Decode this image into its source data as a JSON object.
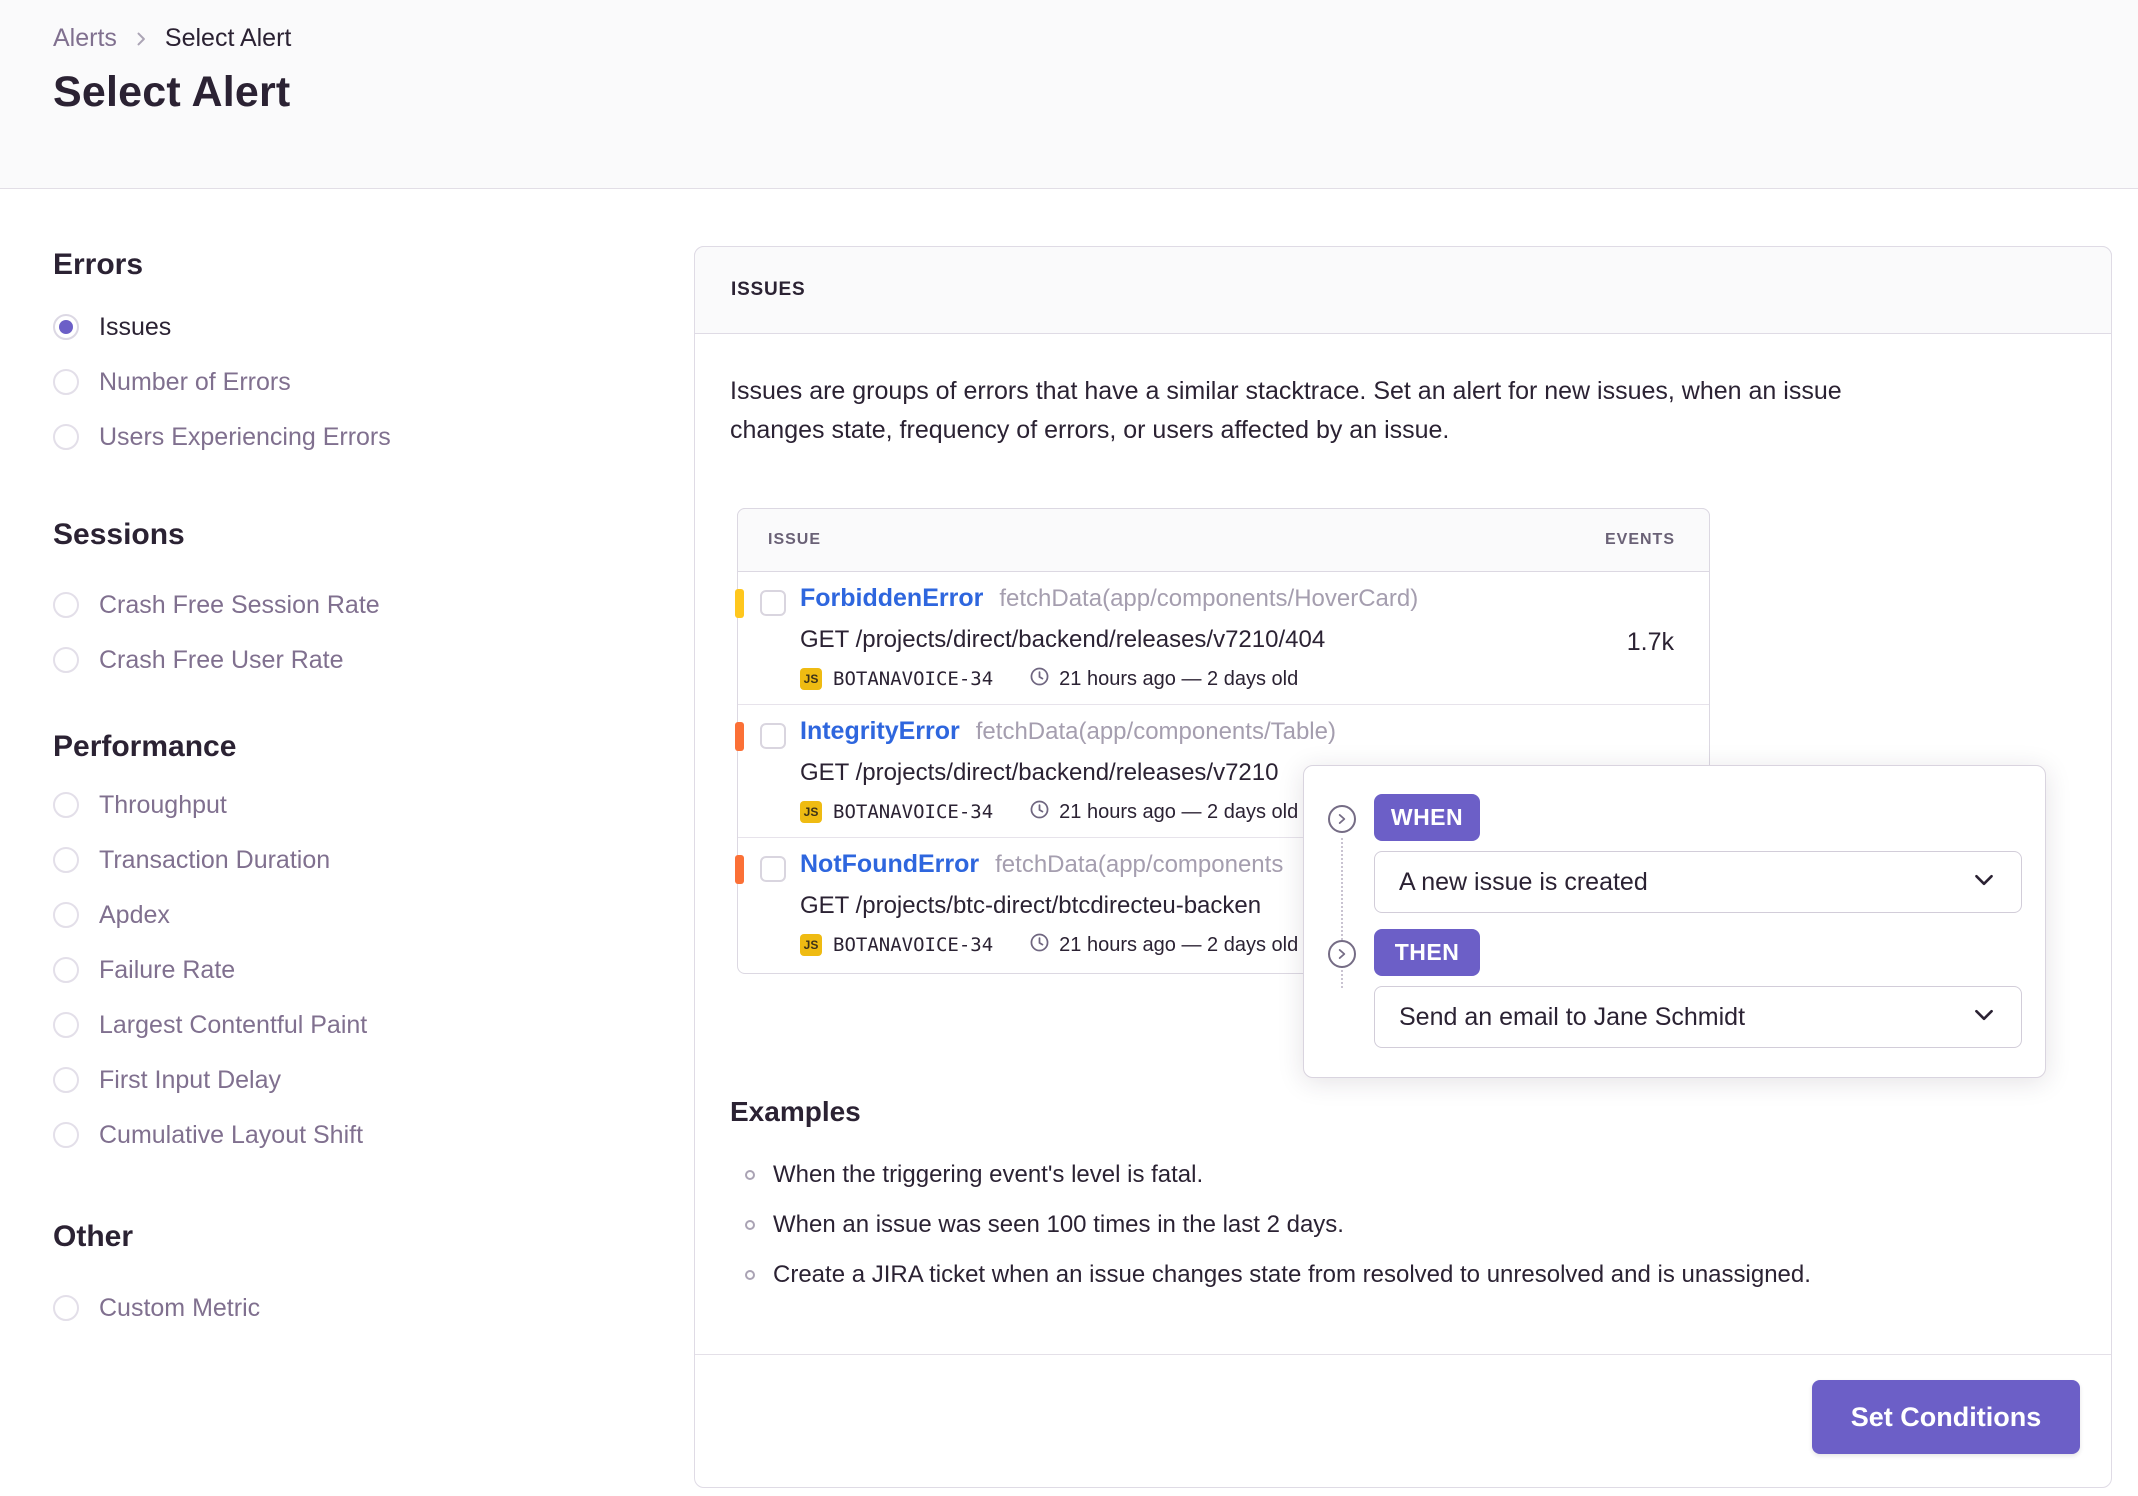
{
  "breadcrumb": {
    "parent": "Alerts",
    "current": "Select Alert"
  },
  "page": {
    "title": "Select Alert"
  },
  "sidebar": {
    "sections": [
      {
        "heading": "Errors",
        "items": [
          {
            "label": "Issues",
            "selected": true
          },
          {
            "label": "Number of Errors",
            "selected": false
          },
          {
            "label": "Users Experiencing Errors",
            "selected": false
          }
        ]
      },
      {
        "heading": "Sessions",
        "items": [
          {
            "label": "Crash Free Session Rate",
            "selected": false
          },
          {
            "label": "Crash Free User Rate",
            "selected": false
          }
        ]
      },
      {
        "heading": "Performance",
        "items": [
          {
            "label": "Throughput",
            "selected": false
          },
          {
            "label": "Transaction Duration",
            "selected": false
          },
          {
            "label": "Apdex",
            "selected": false
          },
          {
            "label": "Failure Rate",
            "selected": false
          },
          {
            "label": "Largest Contentful Paint",
            "selected": false
          },
          {
            "label": "First Input Delay",
            "selected": false
          },
          {
            "label": "Cumulative Layout Shift",
            "selected": false
          }
        ]
      },
      {
        "heading": "Other",
        "items": [
          {
            "label": "Custom Metric",
            "selected": false
          }
        ]
      }
    ]
  },
  "panel": {
    "header": "ISSUES",
    "description_line1": "Issues are groups of errors that have a similar stacktrace. Set an alert for new issues, when an issue",
    "description_line2": "changes state, frequency of errors, or users affected by an issue.",
    "table": {
      "columns": {
        "issue": "ISSUE",
        "events": "EVENTS"
      },
      "platform_badge": "JS",
      "rows": [
        {
          "error": "ForbiddenError",
          "transaction": "fetchData(app/components/HoverCard)",
          "request": "GET /projects/direct/backend/releases/v7210/404",
          "project": "BOTANAVOICE-34",
          "age": "21 hours ago — 2 days old",
          "events": "1.7k",
          "level_color": "#ffc71d"
        },
        {
          "error": "IntegrityError",
          "transaction": "fetchData(app/components/Table)",
          "request": "GET /projects/direct/backend/releases/v7210",
          "project": "BOTANAVOICE-34",
          "age": "21 hours ago — 2 days old",
          "level_color": "#fb7036"
        },
        {
          "error": "NotFoundError",
          "transaction": "fetchData(app/components",
          "request": "GET /projects/btc-direct/btcdirecteu-backen",
          "project": "BOTANAVOICE-34",
          "age": "21 hours ago — 2 days old",
          "level_color": "#fb7036"
        }
      ]
    },
    "examples": {
      "heading": "Examples",
      "items": [
        "When the triggering event's level is fatal.",
        "When an issue was seen 100 times in the last 2 days.",
        "Create a JIRA ticket when an issue changes state from resolved to unresolved and is unassigned."
      ]
    },
    "footer": {
      "submit_label": "Set Conditions"
    }
  },
  "builder": {
    "when_label": "WHEN",
    "when_value": "A new issue is created",
    "then_label": "THEN",
    "then_value": "Send an email to Jane Schmidt"
  },
  "colors": {
    "accent_purple": "#6c5fc7",
    "link_blue": "#2e66de",
    "level_yellow": "#ffc71d",
    "level_orange": "#fb7036",
    "js_badge_yellow": "#efbb12",
    "header_bg": "#fafafb",
    "border": "#dfdbe5",
    "text_dark": "#2b2233",
    "text_muted": "#80708f"
  }
}
